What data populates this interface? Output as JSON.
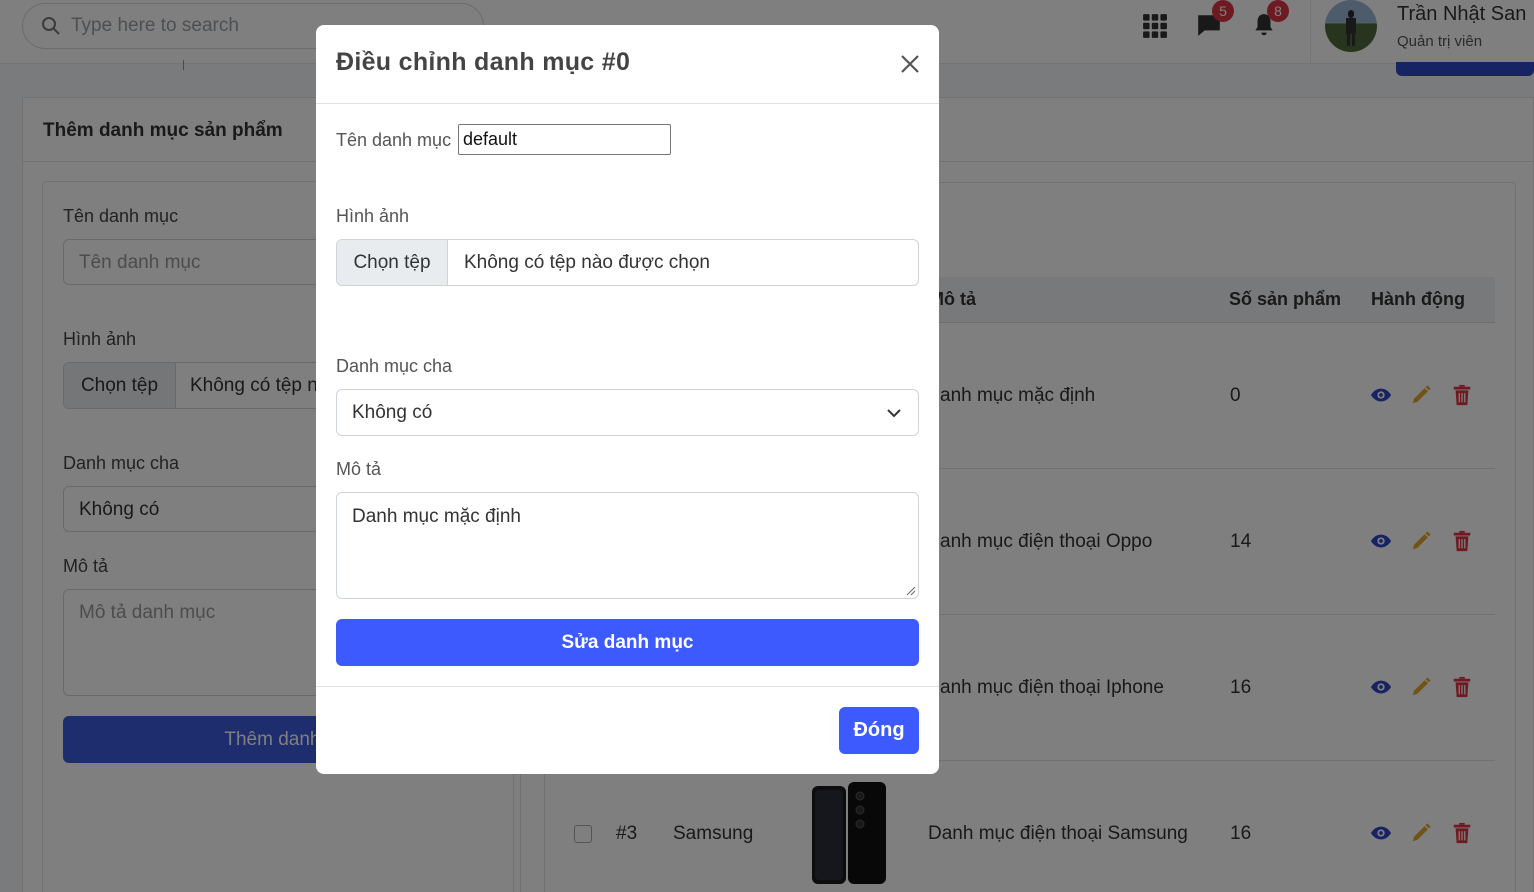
{
  "topbar": {
    "search_placeholder": "Type here to search",
    "messages_count": "5",
    "notifications_count": "8",
    "user_name": "Trần Nhật San",
    "user_role": "Quản trị viên"
  },
  "add_form": {
    "title": "Thêm danh mục sản phẩm",
    "name_label": "Tên danh mục",
    "name_placeholder": "Tên danh mục",
    "image_label": "Hình ảnh",
    "file_button": "Chọn tệp",
    "file_text": "Không có tệp n",
    "parent_label": "Danh mục cha",
    "parent_value": "Không có",
    "desc_label": "Mô tả",
    "desc_placeholder": "Mô tả danh mục",
    "submit_label": "Thêm danh m"
  },
  "table": {
    "headers": [
      "Mô tả",
      "Số sản phẩm",
      "Hành động"
    ],
    "rows": [
      {
        "description": "anh mục mặc định",
        "count": "0"
      },
      {
        "description": "anh mục điện thoại Oppo",
        "count": "14"
      },
      {
        "description": "anh mục điện thoại Iphone",
        "count": "16"
      },
      {
        "id": "#3",
        "name": "Samsung",
        "description": "Danh mục điện thoại Samsung",
        "count": "16"
      }
    ]
  },
  "modal": {
    "title": "Điều chỉnh danh mục #0",
    "name_label": "Tên danh mục",
    "name_value": "default",
    "image_label": "Hình ảnh",
    "file_button": "Chọn tệp",
    "file_text": "Không có tệp nào được chọn",
    "parent_label": "Danh mục cha",
    "parent_value": "Không có",
    "desc_label": "Mô tả",
    "desc_value": "Danh mục mặc định",
    "submit_label": "Sửa danh mục",
    "close_label": "Đóng"
  },
  "colors": {
    "primary": "#3d5afe",
    "danger": "#dc3545",
    "edit": "#e0a82e",
    "view": "#2f46c4"
  },
  "icons": [
    "search-icon",
    "apps-grid-icon",
    "chat-icon",
    "bell-icon",
    "eye-icon",
    "pencil-icon",
    "trash-icon",
    "close-icon",
    "chevron-down-icon"
  ]
}
